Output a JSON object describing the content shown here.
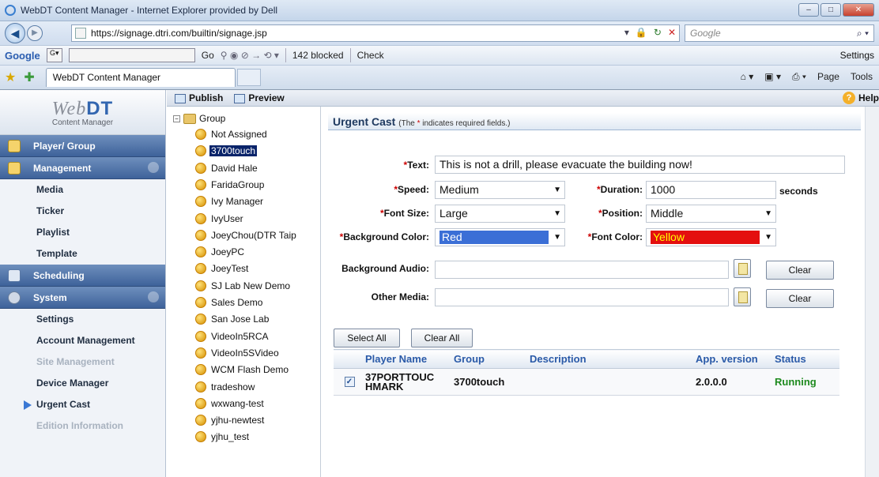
{
  "browser": {
    "title": "WebDT Content Manager - Internet Explorer provided by Dell",
    "url": "https://signage.dtri.com/builtin/signage.jsp",
    "search_placeholder": "Google",
    "google_bar": {
      "logo": "Google",
      "go": "Go",
      "blocked": "142 blocked",
      "check": "Check",
      "settings": "Settings"
    },
    "tab_title": "WebDT Content Manager",
    "right_tools": {
      "page": "Page",
      "tools": "Tools"
    }
  },
  "sidebar": {
    "logo_main": "Web",
    "logo_bold": "DT",
    "logo_sub": "Content Manager",
    "sections": [
      {
        "label": "Player/ Group"
      },
      {
        "label": "Management"
      },
      {
        "label": "Scheduling"
      },
      {
        "label": "System"
      }
    ],
    "management_items": [
      "Media",
      "Ticker",
      "Playlist",
      "Template"
    ],
    "system_items": [
      "Settings",
      "Account Management",
      "Site Management",
      "Device Manager",
      "Urgent Cast",
      "Edition Information"
    ]
  },
  "toolbar": {
    "publish": "Publish",
    "preview": "Preview",
    "help": "Help"
  },
  "tree": {
    "root": "Group",
    "nodes": [
      "Not Assigned",
      "3700touch",
      "David Hale",
      "FaridaGroup",
      "Ivy Manager",
      "IvyUser",
      "JoeyChou(DTR Taip",
      "JoeyPC",
      "JoeyTest",
      "SJ Lab New Demo",
      "Sales Demo",
      "San Jose Lab",
      "VideoIn5RCA",
      "VideoIn5SVideo",
      "WCM Flash Demo",
      "tradeshow",
      "wxwang-test",
      "yjhu-newtest",
      "yjhu_test"
    ],
    "selected": "3700touch"
  },
  "form": {
    "heading": "Urgent Cast",
    "heading_note_pre": "(The ",
    "heading_note_star": "*",
    "heading_note_post": " indicates required fields.)",
    "text_label": "Text:",
    "text_value": "This is not a drill, please evacuate the building now!",
    "speed_label": "Speed:",
    "speed_value": "Medium",
    "duration_label": "Duration:",
    "duration_value": "1000",
    "duration_unit": "seconds",
    "fontsize_label": "Font Size:",
    "fontsize_value": "Large",
    "position_label": "Position:",
    "position_value": "Middle",
    "bgcolor_label": "Background Color:",
    "bgcolor_value": "Red",
    "fontcolor_label": "Font Color:",
    "fontcolor_value": "Yellow",
    "bgaudio_label": "Background Audio:",
    "othermedia_label": "Other Media:",
    "clear": "Clear",
    "select_all": "Select All",
    "clear_all": "Clear All",
    "required_mark": "*"
  },
  "players": {
    "columns": [
      "Player Name",
      "Group",
      "Description",
      "App. version",
      "Status"
    ],
    "rows": [
      {
        "name": "37PORTTOUCHMARK",
        "name_line1": "37PORTTOUC",
        "name_line2": "HMARK",
        "group": "3700touch",
        "description": "",
        "version": "2.0.0.0",
        "status": "Running",
        "checked": true
      }
    ]
  },
  "colors": {
    "accent": "#3e629a",
    "selection": "#0a246a",
    "running": "#1e8a1e",
    "bg_red": "#e11",
    "font_yellow": "#ffff00",
    "required": "#cc0000"
  }
}
